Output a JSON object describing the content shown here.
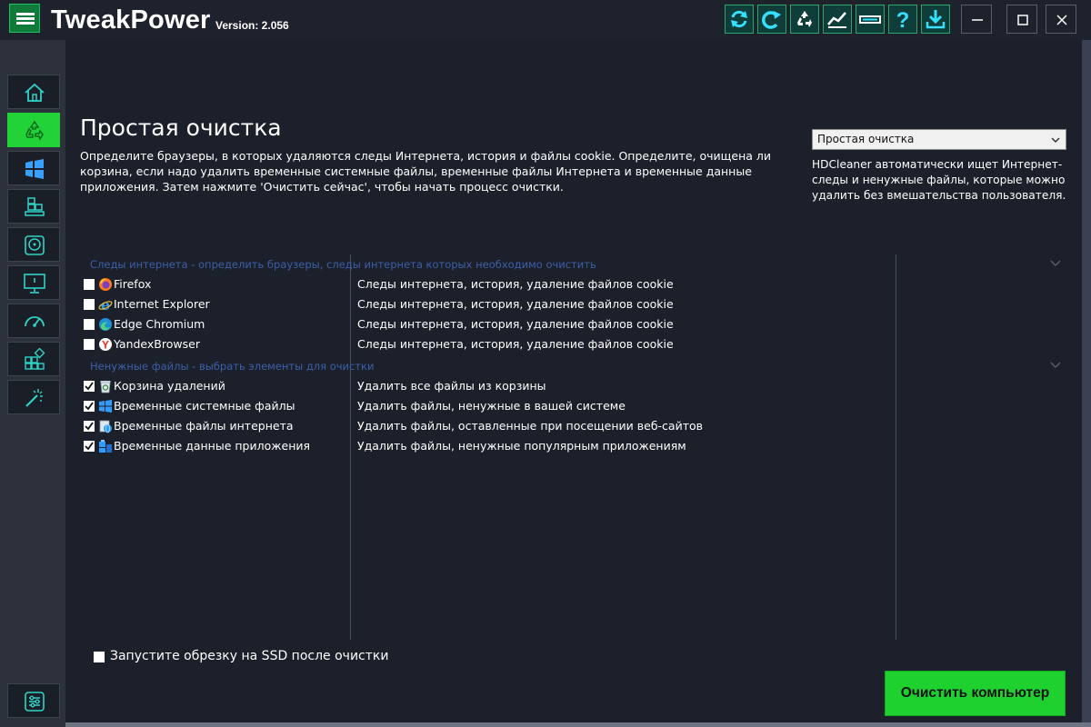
{
  "app": {
    "title": "TweakPower",
    "version": "Version: 2.056"
  },
  "toolbar": {
    "icons": [
      "refresh-icon",
      "redo-icon",
      "recycle-icon",
      "chart-icon",
      "memory-icon",
      "help-icon",
      "download-icon"
    ]
  },
  "window_controls": [
    "minimize-icon",
    "maximize-icon",
    "close-icon"
  ],
  "sidebar": {
    "items": [
      {
        "icon": "home-icon",
        "active": false
      },
      {
        "icon": "recycle-icon",
        "active": true
      },
      {
        "icon": "windows-icon",
        "active": false
      },
      {
        "icon": "registry-icon",
        "active": false
      },
      {
        "icon": "disk-icon",
        "active": false
      },
      {
        "icon": "monitor-icon",
        "active": false
      },
      {
        "icon": "speedometer-icon",
        "active": false
      },
      {
        "icon": "tiles-icon",
        "active": false
      },
      {
        "icon": "magic-wand-icon",
        "active": false
      }
    ],
    "bottom_icon": "settings-sliders-icon"
  },
  "main": {
    "title": "Простая очистка",
    "description": "Определите браузеры, в которых удаляются следы Интернета, история и файлы cookie. Определите, очищена ли корзина, если надо удалить временные системные файлы, временные файлы Интернета и временные данные приложения. Затем нажмите 'Очистить сейчас', чтобы начать процесс очистки.",
    "mode_select": {
      "value": "Простая очистка"
    },
    "mode_note": "HDCleaner автоматически ищет Интернет-следы и ненужные файлы, которые можно удалить без вмешательства пользователя."
  },
  "sections": [
    {
      "header": "Следы интернета - определить браузеры, следы интернета которых необходимо очистить",
      "items": [
        {
          "name": "Firefox",
          "icon": "firefox-icon",
          "checked": false,
          "desc": "Следы интернета, история, удаление файлов cookie"
        },
        {
          "name": "Internet Explorer",
          "icon": "internet-explorer-icon",
          "checked": false,
          "desc": "Следы интернета, история, удаление файлов cookie"
        },
        {
          "name": "Edge Chromium",
          "icon": "edge-icon",
          "checked": false,
          "desc": "Следы интернета, история, удаление файлов cookie"
        },
        {
          "name": "YandexBrowser",
          "icon": "yandex-icon",
          "checked": false,
          "desc": "Следы интернета, история, удаление файлов cookie"
        }
      ]
    },
    {
      "header": "Ненужные файлы - выбрать элементы для очистки",
      "items": [
        {
          "name": "Корзина удалений",
          "icon": "recycle-bin-icon",
          "checked": true,
          "desc": "Удалить все файлы из корзины"
        },
        {
          "name": "Временные системные файлы",
          "icon": "windows-icon",
          "checked": true,
          "desc": "Удалить файлы, ненужные в вашей системе"
        },
        {
          "name": "Временные файлы интернета",
          "icon": "internet-files-icon",
          "checked": true,
          "desc": "Удалить файлы, оставленные при посещении веб-сайтов"
        },
        {
          "name": "Временные данные приложения",
          "icon": "app-data-icon",
          "checked": true,
          "desc": "Удалить файлы, ненужные популярным приложениям"
        }
      ]
    }
  ],
  "ssd_option": {
    "label": "Запустите обрезку на SSD после очистки",
    "checked": false
  },
  "clean_button": {
    "label": "Очистить компьютер"
  },
  "colors": {
    "accent": "#21d337",
    "background": "#1c202b",
    "sidebar": "#2c313b",
    "section_header": "#3d5fa8"
  }
}
